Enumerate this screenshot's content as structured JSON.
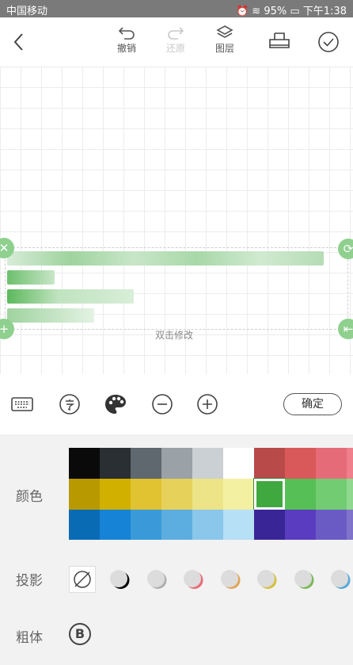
{
  "status": {
    "carrier": "中国移动",
    "battery": "95%",
    "time": "下午1:38"
  },
  "toolbar": {
    "undo": "撤销",
    "redo": "还原",
    "layers": "图层"
  },
  "canvas": {
    "hint": "双击修改"
  },
  "tools": {
    "confirm": "确定"
  },
  "panel": {
    "color_label": "颜色",
    "shadow_label": "投影",
    "bold_label": "粗体",
    "bold_glyph": "B",
    "colors": [
      [
        "#0a0a0a",
        "#2a2f33",
        "#5f686f",
        "#9aa1a7",
        "#cbd0d4",
        "#ffffff",
        "#b84a4a",
        "#d9595a",
        "#e66b78",
        "#ef7f8a"
      ],
      [
        "#b89a00",
        "#d2b000",
        "#e1c230",
        "#e6d15a",
        "#ece487",
        "#f4f0a2",
        "#3fa83f",
        "#56bf56",
        "#72cc72",
        "#8fd98f"
      ],
      [
        "#0a6bb5",
        "#1683d6",
        "#3a9ad9",
        "#5daee0",
        "#8ac7ea",
        "#b6e0f5",
        "#3a2596",
        "#5a3cc0",
        "#6a5bc4",
        "#7f73cc"
      ]
    ],
    "selected_color": "#3fa83f",
    "shadow_accents": [
      "#000000",
      "#b0b0b0",
      "#e86b78",
      "#e0a55a",
      "#d4bf3c",
      "#7cb85a",
      "#5aaad8"
    ]
  }
}
